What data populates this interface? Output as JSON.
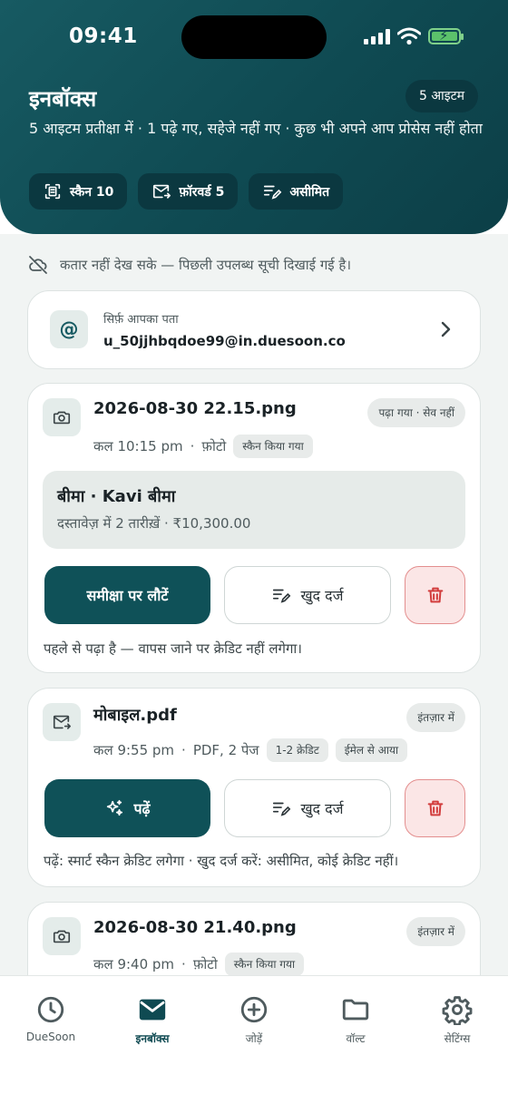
{
  "status_bar": {
    "time": "09:41"
  },
  "header": {
    "title": "इनबॉक्स",
    "badge": "5 आइटम",
    "subtitle": "5 आइटम प्रतीक्षा में · 1 पढ़े गए, सहेजे नहीं गए · कुछ भी अपने आप प्रोसेस नहीं होता",
    "chips": [
      {
        "label": "स्कैन 10",
        "icon": "scan-icon"
      },
      {
        "label": "फ़ॉरवर्ड 5",
        "icon": "forward-mail-icon"
      },
      {
        "label": "असीमित",
        "icon": "manual-entry-icon"
      }
    ]
  },
  "offline_notice": "कतार नहीं देख सके — पिछली उपलब्ध सूची दिखाई गई है।",
  "address": {
    "label": "सिर्फ़ आपका पता",
    "value": "u_50jjhbqdoe99@in.duesoon.co",
    "icon": "@"
  },
  "items": [
    {
      "name": "2026-08-30 22.15.png",
      "status": "पढ़ा गया · सेव नहीं",
      "time": "कल 10:15 pm",
      "type": "फ़ोटो",
      "tags": [
        "स्कैन किया गया"
      ],
      "summary": {
        "title": "बीमा · Kavi बीमा",
        "subtitle": "दस्तावेज़ में 2 तारीख़ें · ₹10,300.00"
      },
      "primary_label": "समीक्षा पर लौटें",
      "manual_label": "खुद दर्ज",
      "note": "पहले से पढ़ा है — वापस जाने पर क्रेडिट नहीं लगेगा।"
    },
    {
      "name": "मोबाइल.pdf",
      "status": "इंतज़ार में",
      "time": "कल 9:55 pm",
      "type": "PDF, 2 पेज",
      "tags": [
        "1-2 क्रेडिट",
        "ईमेल से आया"
      ],
      "primary_label": "पढ़ें",
      "manual_label": "खुद दर्ज",
      "note": "पढ़ें: स्मार्ट स्कैन क्रेडिट लगेगा · खुद दर्ज करें: असीमित, कोई क्रेडिट नहीं।"
    },
    {
      "name": "2026-08-30 21.40.png",
      "status": "इंतज़ार में",
      "time": "कल 9:40 pm",
      "type": "फ़ोटो",
      "tags": [
        "स्कैन किया गया"
      ]
    }
  ],
  "nav": [
    {
      "label": "DueSoon",
      "icon": "clock-icon"
    },
    {
      "label": "इनबॉक्स",
      "icon": "mail-icon",
      "active": true
    },
    {
      "label": "जोड़ें",
      "icon": "add-circle-icon"
    },
    {
      "label": "वॉल्ट",
      "icon": "folder-icon"
    },
    {
      "label": "सेटिंग्स",
      "icon": "gear-icon"
    }
  ],
  "colors": {
    "brand": "#0f4a52",
    "accent": "#175a62",
    "danger": "#d23c3c"
  }
}
